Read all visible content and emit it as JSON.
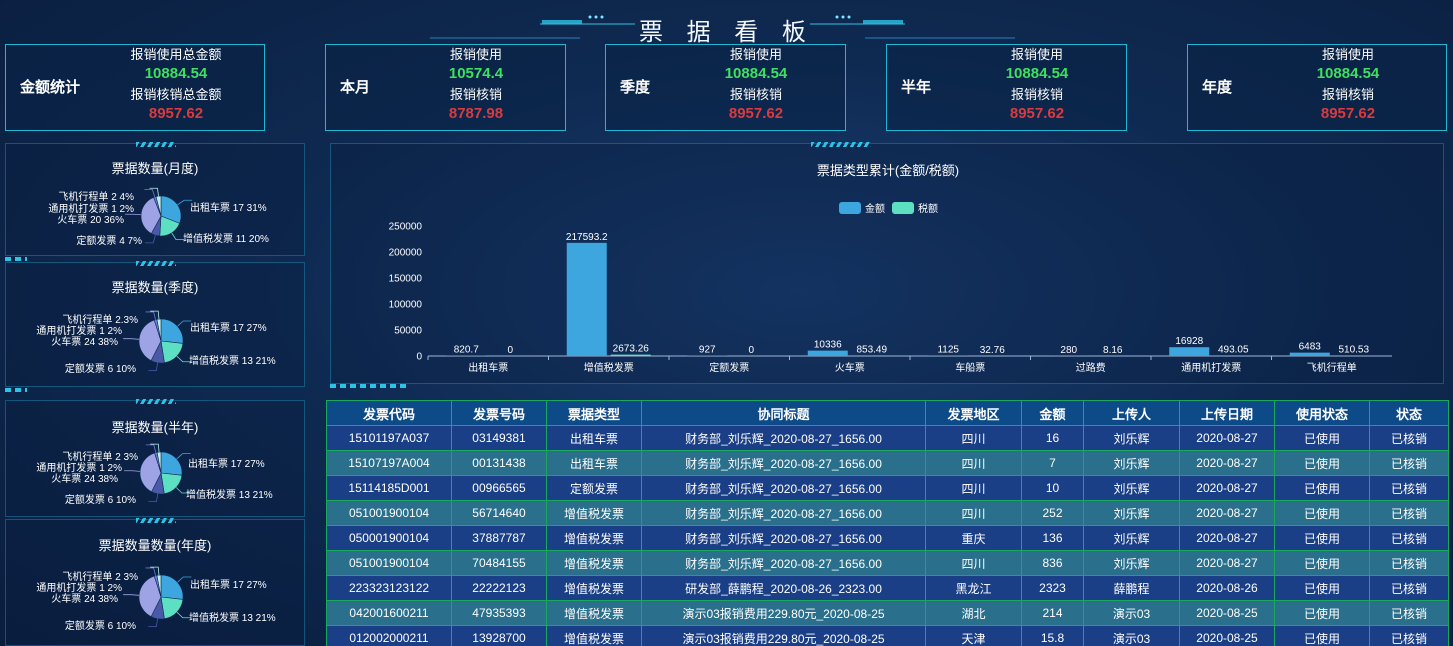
{
  "header": {
    "title": "票 据 看 板"
  },
  "summary": {
    "title": "金额统计",
    "use_label": "报销使用总金额",
    "use_value": "10884.54",
    "verify_label": "报销核销总金额",
    "verify_value": "8957.62"
  },
  "cards": [
    {
      "title": "本月",
      "use_label": "报销使用",
      "use_value": "10574.4",
      "verify_label": "报销核销",
      "verify_value": "8787.98"
    },
    {
      "title": "季度",
      "use_label": "报销使用",
      "use_value": "10884.54",
      "verify_label": "报销核销",
      "verify_value": "8957.62"
    },
    {
      "title": "半年",
      "use_label": "报销使用",
      "use_value": "10884.54",
      "verify_label": "报销核销",
      "verify_value": "8957.62"
    },
    {
      "title": "年度",
      "use_label": "报销使用",
      "use_value": "10884.54",
      "verify_label": "报销核销",
      "verify_value": "8957.62"
    }
  ],
  "pies": [
    {
      "title": "票据数量(月度)",
      "slices": [
        {
          "label": "出租车票 17 31%",
          "value": 31,
          "color": "#3ea6df"
        },
        {
          "label": "增值税发票 11 20%",
          "value": 20,
          "color": "#5de0c2"
        },
        {
          "label": "定额发票 4 7%",
          "value": 7,
          "color": "#4a5aa8"
        },
        {
          "label": "火车票 20 36%",
          "value": 36,
          "color": "#9ea3e6"
        },
        {
          "label": "通用机打发票 1 2%",
          "value": 2,
          "color": "#6c7bd4"
        },
        {
          "label": "飞机行程单 2 4%",
          "value": 4,
          "color": "#b8f0ea"
        }
      ]
    },
    {
      "title": "票据数量(季度)",
      "slices": [
        {
          "label": "出租车票 17 27%",
          "value": 27,
          "color": "#3ea6df"
        },
        {
          "label": "增值税发票 13 21%",
          "value": 21,
          "color": "#5de0c2"
        },
        {
          "label": "定额发票 6 10%",
          "value": 10,
          "color": "#4a5aa8"
        },
        {
          "label": "火车票 24 38%",
          "value": 38,
          "color": "#9ea3e6"
        },
        {
          "label": "通用机打发票 1 2%",
          "value": 2,
          "color": "#6c7bd4"
        },
        {
          "label": "飞机行程单 2.3%",
          "value": 3,
          "color": "#b8f0ea"
        }
      ]
    },
    {
      "title": "票据数量(半年)",
      "slices": [
        {
          "label": "出租车票 17 27%",
          "value": 27,
          "color": "#3ea6df"
        },
        {
          "label": "增值税发票 13 21%",
          "value": 21,
          "color": "#5de0c2"
        },
        {
          "label": "定额发票 6 10%",
          "value": 10,
          "color": "#4a5aa8"
        },
        {
          "label": "火车票 24 38%",
          "value": 38,
          "color": "#9ea3e6"
        },
        {
          "label": "通用机打发票 1 2%",
          "value": 2,
          "color": "#6c7bd4"
        },
        {
          "label": "飞机行程单 2 3%",
          "value": 3,
          "color": "#b8f0ea"
        }
      ]
    },
    {
      "title": "票据数量数量(年度)",
      "slices": [
        {
          "label": "出租车票 17 27%",
          "value": 27,
          "color": "#3ea6df"
        },
        {
          "label": "增值税发票 13 21%",
          "value": 21,
          "color": "#5de0c2"
        },
        {
          "label": "定额发票 6 10%",
          "value": 10,
          "color": "#4a5aa8"
        },
        {
          "label": "火车票 24 38%",
          "value": 38,
          "color": "#9ea3e6"
        },
        {
          "label": "通用机打发票 1 2%",
          "value": 2,
          "color": "#6c7bd4"
        },
        {
          "label": "飞机行程单 2 3%",
          "value": 3,
          "color": "#b8f0ea"
        }
      ]
    }
  ],
  "chart_data": {
    "type": "bar",
    "title": "票据类型累计(金额/税额)",
    "categories": [
      "出租车票",
      "增值税发票",
      "定额发票",
      "火车票",
      "车船票",
      "过路费",
      "通用机打发票",
      "飞机行程单"
    ],
    "series": [
      {
        "name": "金额",
        "color": "#3ea6df",
        "values": [
          820.7,
          217593.2,
          927,
          10336,
          1125,
          280,
          16928,
          6483
        ]
      },
      {
        "name": "税额",
        "color": "#5de0c2",
        "values": [
          0,
          2673.26,
          0,
          853.49,
          32.76,
          8.16,
          493.05,
          510.53
        ]
      }
    ],
    "value_labels": [
      [
        "820.7",
        "217593.2",
        "927",
        "10336",
        "1125",
        "280",
        "16928",
        "6483"
      ],
      [
        "0",
        "2673.26",
        "0",
        "853.49",
        "32.76",
        "8.16",
        "493.05",
        "510.53"
      ]
    ],
    "yticks": [
      "0",
      "50000",
      "100000",
      "150000",
      "200000",
      "250000"
    ],
    "ylim": [
      0,
      250000
    ],
    "legend_position": "top-center"
  },
  "table": {
    "headers": [
      "发票代码",
      "发票号码",
      "票据类型",
      "协同标题",
      "发票地区",
      "金额",
      "上传人",
      "上传日期",
      "使用状态",
      "状态"
    ],
    "rows": [
      [
        "15101197A037",
        "03149381",
        "出租车票",
        "财务部_刘乐辉_2020-08-27_1656.00",
        "四川",
        "16",
        "刘乐辉",
        "2020-08-27",
        "已使用",
        "已核销"
      ],
      [
        "15107197A004",
        "00131438",
        "出租车票",
        "财务部_刘乐辉_2020-08-27_1656.00",
        "四川",
        "7",
        "刘乐辉",
        "2020-08-27",
        "已使用",
        "已核销"
      ],
      [
        "15114185D001",
        "00966565",
        "定额发票",
        "财务部_刘乐辉_2020-08-27_1656.00",
        "四川",
        "10",
        "刘乐辉",
        "2020-08-27",
        "已使用",
        "已核销"
      ],
      [
        "051001900104",
        "56714640",
        "增值税发票",
        "财务部_刘乐辉_2020-08-27_1656.00",
        "四川",
        "252",
        "刘乐辉",
        "2020-08-27",
        "已使用",
        "已核销"
      ],
      [
        "050001900104",
        "37887787",
        "增值税发票",
        "财务部_刘乐辉_2020-08-27_1656.00",
        "重庆",
        "136",
        "刘乐辉",
        "2020-08-27",
        "已使用",
        "已核销"
      ],
      [
        "051001900104",
        "70484155",
        "增值税发票",
        "财务部_刘乐辉_2020-08-27_1656.00",
        "四川",
        "836",
        "刘乐辉",
        "2020-08-27",
        "已使用",
        "已核销"
      ],
      [
        "223323123122",
        "22222123",
        "增值税发票",
        "研发部_薛鹏程_2020-08-26_2323.00",
        "黑龙江",
        "2323",
        "薛鹏程",
        "2020-08-26",
        "已使用",
        "已核销"
      ],
      [
        "042001600211",
        "47935393",
        "增值税发票",
        "演示03报销费用229.80元_2020-08-25",
        "湖北",
        "214",
        "演示03",
        "2020-08-25",
        "已使用",
        "已核销"
      ],
      [
        "012002000211",
        "13928700",
        "增值税发票",
        "演示03报销费用229.80元_2020-08-25",
        "天津",
        "15.8",
        "演示03",
        "2020-08-25",
        "已使用",
        "已核销"
      ]
    ]
  }
}
